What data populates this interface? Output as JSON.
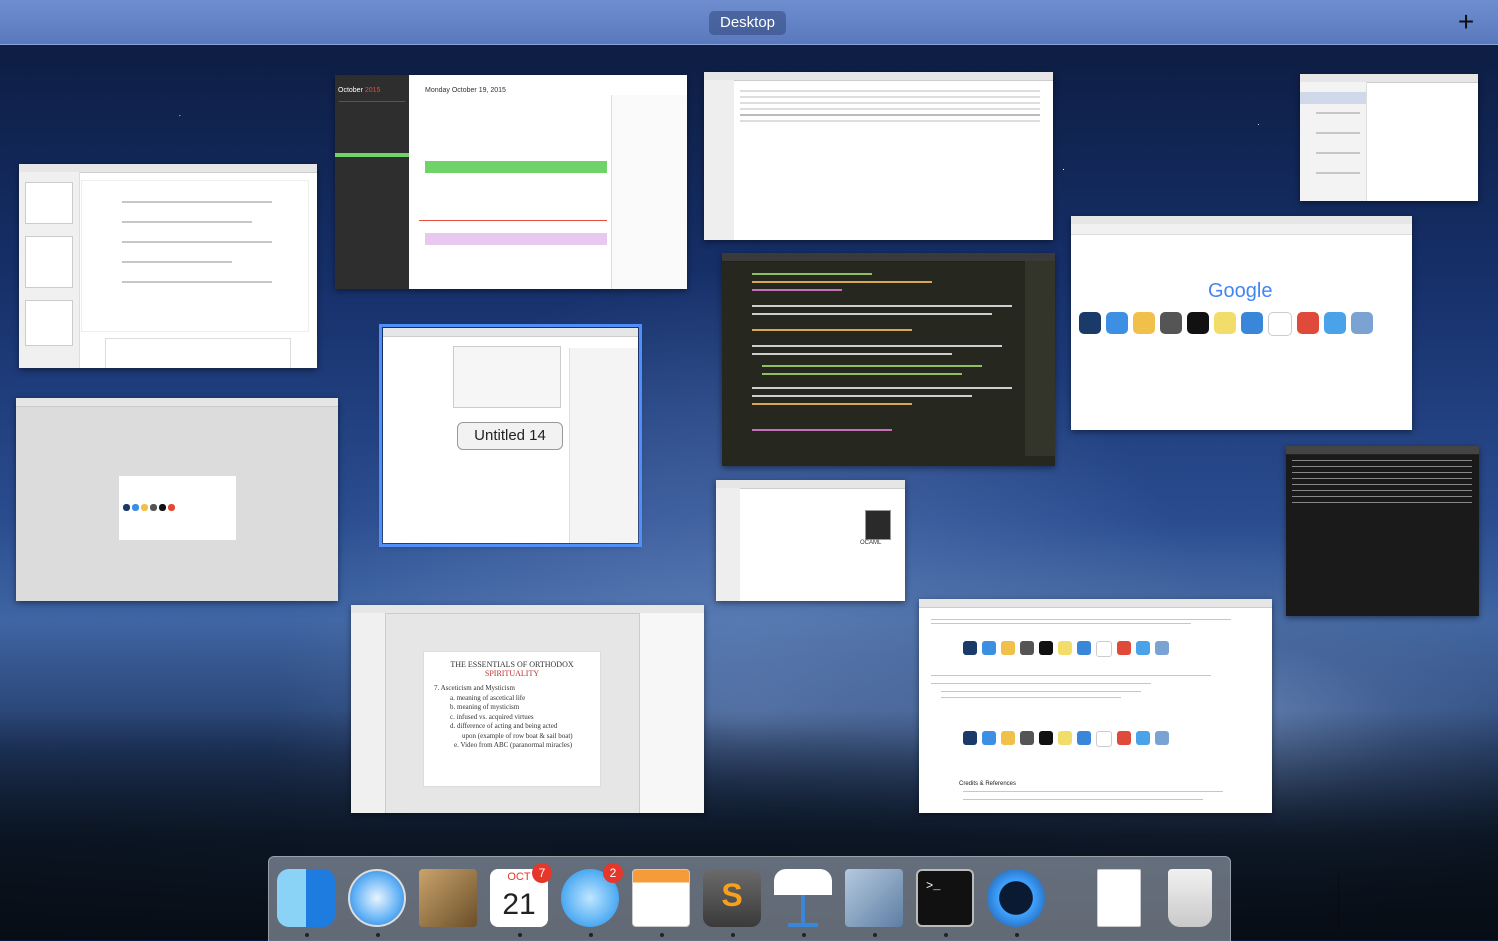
{
  "topbar": {
    "space_label": "Desktop",
    "add_space_glyph": "+"
  },
  "windows": {
    "calendar": {
      "month": "October",
      "year": "2015",
      "day_header": "Monday October 19, 2015"
    },
    "pages_untitled": {
      "label": "Untitled 14"
    },
    "google_safari": {
      "logo": "Google"
    },
    "keynote": {
      "slide_title_line1": "THE ESSENTIALS OF ORTHODOX",
      "slide_title_line2": "SPIRITUALITY",
      "slide_lines": [
        "7. Asceticism and Mysticism",
        "a. meaning of ascetical life",
        "b. meaning of mysticism",
        "c. infused vs. acquired virtues",
        "d. difference of acting and being acted",
        "upon (example of row boat & sail boat)",
        "e. Video from ABC (paranormal miracles)"
      ]
    },
    "finder": {
      "file_label": "OCAML"
    },
    "article": {
      "heading": "Credits & References"
    }
  },
  "dock": {
    "items": [
      {
        "name": "Finder",
        "icon": "finder-icon",
        "running": true
      },
      {
        "name": "Safari",
        "icon": "safari-icon",
        "running": true
      },
      {
        "name": "Mail",
        "icon": "mail-icon",
        "running": false
      },
      {
        "name": "Calendar",
        "icon": "calendar-icon",
        "running": true,
        "badge": "7",
        "month": "OCT",
        "day": "21"
      },
      {
        "name": "Messages",
        "icon": "messages-icon",
        "running": true,
        "badge": "2"
      },
      {
        "name": "Pages",
        "icon": "pages-icon",
        "running": true
      },
      {
        "name": "Sublime Text",
        "icon": "sublime-icon",
        "running": true,
        "letter": "S"
      },
      {
        "name": "Keynote",
        "icon": "keynote-icon",
        "running": true
      },
      {
        "name": "Preview",
        "icon": "preview-icon",
        "running": true
      },
      {
        "name": "Terminal",
        "icon": "terminal-icon",
        "running": true,
        "prompt": ">_"
      },
      {
        "name": "QuickTime Player",
        "icon": "quicktime-icon",
        "running": true
      },
      {
        "name": "Documents",
        "icon": "documents-stack-icon",
        "running": false
      },
      {
        "name": "Trash",
        "icon": "trash-icon",
        "running": false
      }
    ]
  },
  "colors": {
    "topbar": "#6f8ed0",
    "selection": "#4f8ff7",
    "badge": "#e5372b"
  }
}
